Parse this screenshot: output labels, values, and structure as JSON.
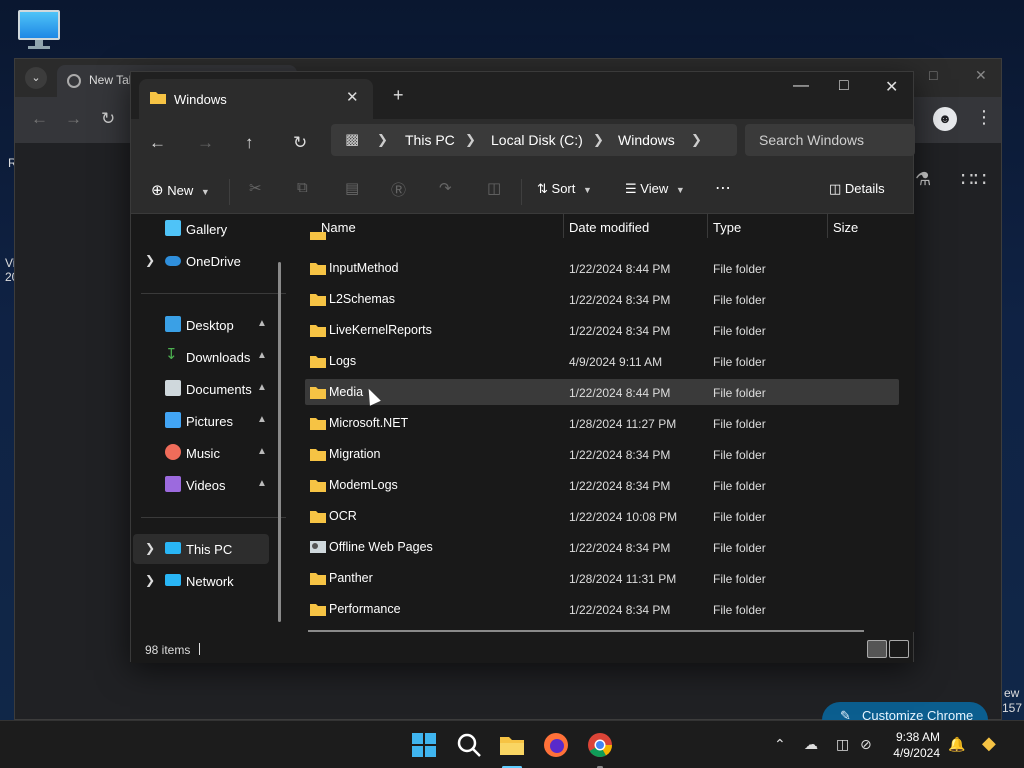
{
  "desktop": {
    "edge_text_left": [
      "R",
      "Vi",
      "20"
    ],
    "edge_text_right": [
      "ew",
      "157"
    ]
  },
  "chrome": {
    "tab_title": "New Tab",
    "customize_label": "Customize Chrome"
  },
  "explorer": {
    "tab_title": "Windows",
    "address": {
      "segments": [
        "This PC",
        "Local Disk (C:)",
        "Windows"
      ]
    },
    "search_placeholder": "Search Windows",
    "commands": {
      "new": "New",
      "sort": "Sort",
      "view": "View",
      "details": "Details"
    },
    "nav_pane": {
      "items": [
        {
          "label": "Gallery"
        },
        {
          "label": "OneDrive"
        },
        {
          "label": "Desktop"
        },
        {
          "label": "Downloads"
        },
        {
          "label": "Documents"
        },
        {
          "label": "Pictures"
        },
        {
          "label": "Music"
        },
        {
          "label": "Videos"
        },
        {
          "label": "This PC"
        },
        {
          "label": "Network"
        }
      ]
    },
    "columns": {
      "name": "Name",
      "date": "Date modified",
      "type": "Type",
      "size": "Size"
    },
    "rows": [
      {
        "name": "InputMethod",
        "date": "1/22/2024 8:44 PM",
        "type": "File folder"
      },
      {
        "name": "L2Schemas",
        "date": "1/22/2024 8:34 PM",
        "type": "File folder"
      },
      {
        "name": "LiveKernelReports",
        "date": "1/22/2024 8:34 PM",
        "type": "File folder"
      },
      {
        "name": "Logs",
        "date": "4/9/2024 9:11 AM",
        "type": "File folder"
      },
      {
        "name": "Media",
        "date": "1/22/2024 8:44 PM",
        "type": "File folder"
      },
      {
        "name": "Microsoft.NET",
        "date": "1/28/2024 11:27 PM",
        "type": "File folder"
      },
      {
        "name": "Migration",
        "date": "1/22/2024 8:34 PM",
        "type": "File folder"
      },
      {
        "name": "ModemLogs",
        "date": "1/22/2024 8:34 PM",
        "type": "File folder"
      },
      {
        "name": "OCR",
        "date": "1/22/2024 10:08 PM",
        "type": "File folder"
      },
      {
        "name": "Offline Web Pages",
        "date": "1/22/2024 8:34 PM",
        "type": "File folder"
      },
      {
        "name": "Panther",
        "date": "1/28/2024 11:31 PM",
        "type": "File folder"
      },
      {
        "name": "Performance",
        "date": "1/22/2024 8:34 PM",
        "type": "File folder"
      }
    ],
    "status": {
      "item_count": "98 items"
    }
  },
  "taskbar": {
    "time": "9:38 AM",
    "date": "4/9/2024"
  },
  "colors": {
    "folder": "#f6c344",
    "accent": "#60cdff",
    "selected_row": "#3a3a3a"
  }
}
